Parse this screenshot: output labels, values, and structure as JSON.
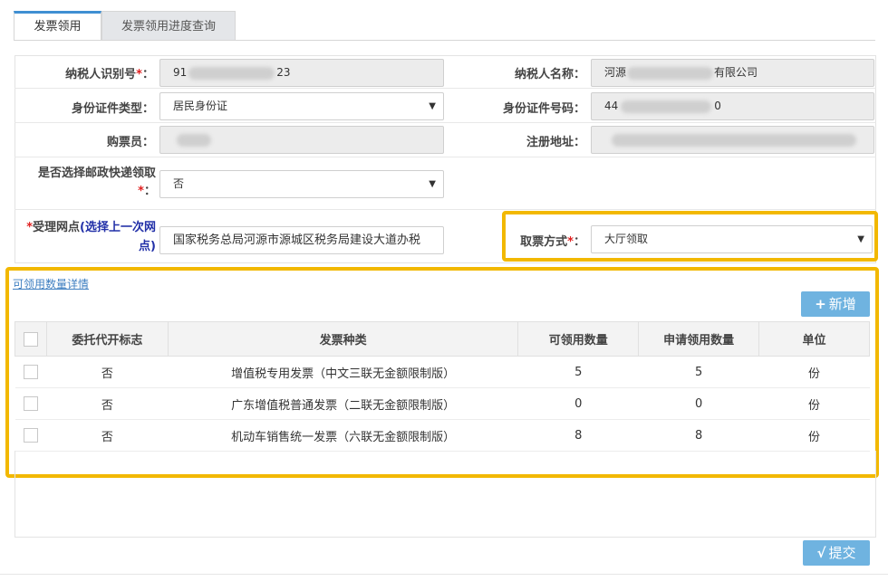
{
  "tabs": [
    {
      "label": "发票领用"
    },
    {
      "label": "发票领用进度查询"
    }
  ],
  "form": {
    "taxpayer_id_label": "纳税人识别号",
    "taxpayer_id_prefix": "91",
    "taxpayer_id_suffix": "23",
    "taxpayer_name_label": "纳税人名称：",
    "taxpayer_name_prefix": "河源",
    "taxpayer_name_suffix": "有限公司",
    "id_type_label": "身份证件类型：",
    "id_type_value": "居民身份证",
    "id_number_label": "身份证件号码：",
    "id_number_prefix": "44",
    "id_number_suffix": "0",
    "buyer_label": "购票员：",
    "reg_address_label": "注册地址：",
    "postal_label_line1": "是否选择邮政快递领取",
    "postal_value": "否",
    "office_label_prefix": "受理网点",
    "office_label_link": "(选择上一次网点)",
    "office_value": "国家税务总局河源市源城区税务局建设大道办税",
    "pickup_label": "取票方式",
    "pickup_value": "大厅领取",
    "required_mark": "*",
    "colon": "："
  },
  "detail_link": "可领用数量详情",
  "add_button": {
    "icon": "+",
    "label": "新增"
  },
  "table": {
    "headers": [
      "委托代开标志",
      "发票种类",
      "可领用数量",
      "申请领用数量",
      "单位"
    ],
    "rows": [
      {
        "entrust": "否",
        "type": "增值税专用发票（中文三联无金额限制版）",
        "available": "5",
        "requested": "5",
        "unit": "份"
      },
      {
        "entrust": "否",
        "type": "广东增值税普通发票（二联无金额限制版）",
        "available": "0",
        "requested": "0",
        "unit": "份"
      },
      {
        "entrust": "否",
        "type": "机动车销售统一发票（六联无金额限制版）",
        "available": "8",
        "requested": "8",
        "unit": "份"
      }
    ]
  },
  "submit_button": {
    "icon": "√",
    "label": "提交"
  },
  "colors": {
    "accent": "#6fb3e0",
    "highlight": "#f2b800",
    "required": "#e02020"
  }
}
